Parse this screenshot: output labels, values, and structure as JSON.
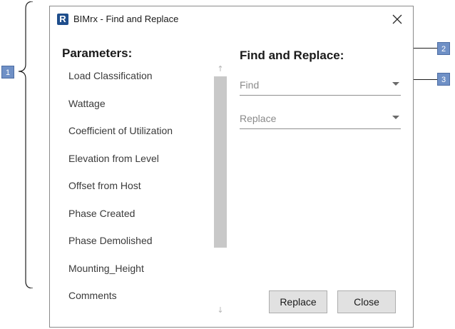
{
  "window": {
    "icon_letter": "R",
    "title": "BIMrx - Find and Replace"
  },
  "callouts": [
    "1",
    "2",
    "3"
  ],
  "parameters": {
    "heading": "Parameters:",
    "items": [
      "Load Classification",
      "Wattage",
      "Coefficient of Utilization",
      "Elevation from Level",
      "Offset from Host",
      "Phase Created",
      "Phase Demolished",
      "Mounting_Height",
      "Comments"
    ]
  },
  "find_replace": {
    "heading": "Find and Replace:",
    "find_placeholder": "Find",
    "replace_placeholder": "Replace"
  },
  "buttons": {
    "replace_label": "Replace",
    "close_label": "Close"
  },
  "colors": {
    "callout_badge": "#6f90c6",
    "app_icon": "#1f4e8c",
    "button_face": "#e1e1e1"
  },
  "icons": {
    "close": "close-icon",
    "scroll_up": "arrow-up-icon",
    "scroll_down": "arrow-down-icon",
    "dropdown": "chevron-down-icon"
  }
}
